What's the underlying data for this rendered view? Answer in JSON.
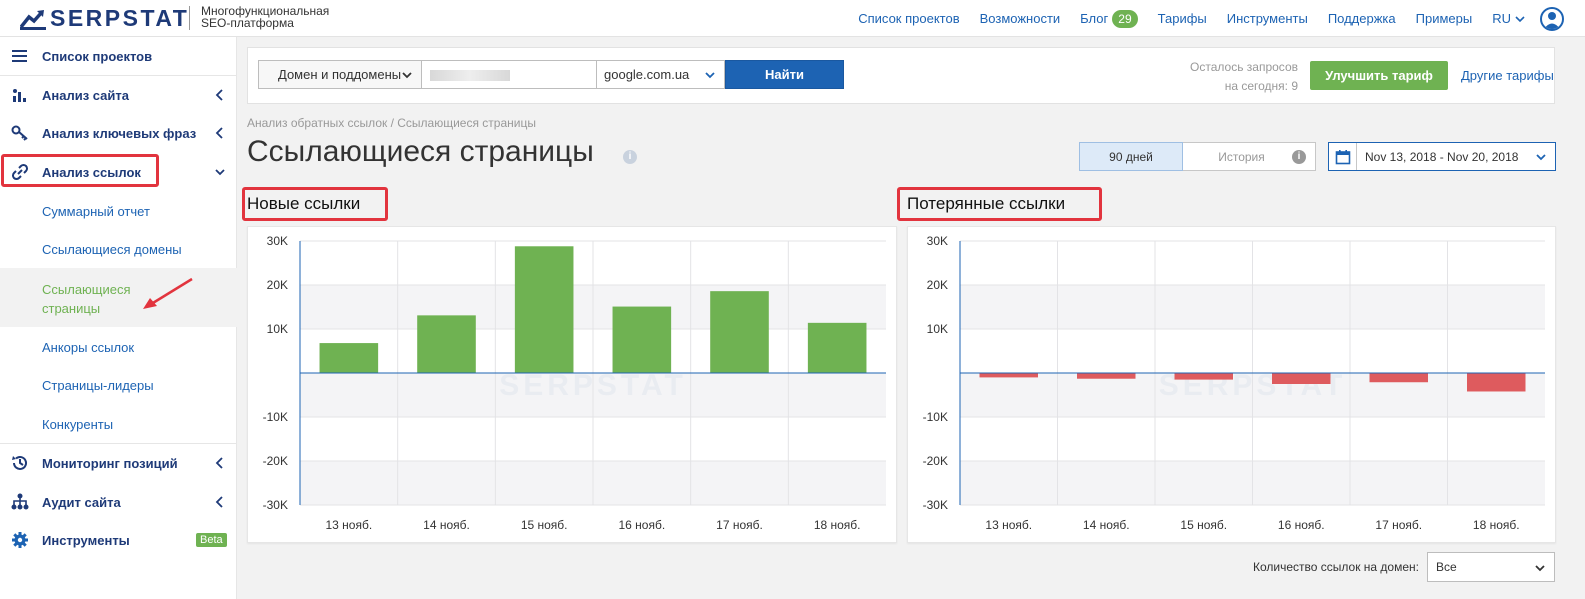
{
  "header": {
    "logo_text": "SERPSTAT",
    "tagline_line1": "Многофункциональная",
    "tagline_line2": "SEO-платформа",
    "nav": [
      "Список проектов",
      "Возможности",
      "Блог",
      "Тарифы",
      "Инструменты",
      "Поддержка",
      "Примеры"
    ],
    "blog_badge": "29",
    "lang": "RU"
  },
  "sidebar": {
    "projects": "Список проектов",
    "site_analysis": "Анализ сайта",
    "keyword_analysis": "Анализ ключевых фраз",
    "link_analysis": "Анализ ссылок",
    "subitems": [
      "Суммарный отчет",
      "Ссылающиеся домены",
      "Ссылающиеся",
      "страницы",
      "Анкоры ссылок",
      "Страницы-лидеры",
      "Конкуренты"
    ],
    "rank_tracking": "Мониторинг позиций",
    "site_audit": "Аудит сайта",
    "tools": "Инструменты",
    "beta": "Beta"
  },
  "search": {
    "scope": "Домен и поддомены",
    "engine": "google.com.ua",
    "find": "Найти",
    "remaining_line1": "Осталось запросов",
    "remaining_line2": "на сегодня: 9",
    "upgrade": "Улучшить тариф",
    "other_plans": "Другие тарифы"
  },
  "page": {
    "breadcrumb": "Анализ обратных ссылок / Ссылающиеся страницы",
    "title": "Ссылающиеся страницы",
    "period_90": "90 дней",
    "period_history": "История",
    "date_range": "Nov 13, 2018 - Nov 20, 2018",
    "per_domain_label": "Количество ссылок на домен:",
    "per_domain_value": "Все"
  },
  "colors": {
    "brand_blue": "#1d63b3",
    "green": "#6fb252",
    "red": "#de5b5e",
    "highlight": "#e2343e"
  },
  "chart_data": [
    {
      "type": "bar",
      "title": "Новые ссылки",
      "watermark": "SERPSTAT",
      "categories": [
        "13 нояб.",
        "14 нояб.",
        "15 нояб.",
        "16 нояб.",
        "17 нояб.",
        "18 нояб."
      ],
      "values": [
        6800,
        13100,
        28800,
        15100,
        18600,
        11400
      ],
      "ylim": [
        -30000,
        30000
      ],
      "yticks": [
        "30K",
        "20K",
        "10K",
        "",
        "-10K",
        "-20K",
        "-30K"
      ],
      "color": "#6fb252",
      "grid": true
    },
    {
      "type": "bar",
      "title": "Потерянные ссылки",
      "watermark": "SERPSTAT",
      "categories": [
        "13 нояб.",
        "14 нояб.",
        "15 нояб.",
        "16 нояб.",
        "17 нояб.",
        "18 нояб."
      ],
      "values": [
        -1000,
        -1300,
        -1500,
        -2500,
        -2100,
        -4200
      ],
      "ylim": [
        -30000,
        30000
      ],
      "yticks": [
        "30K",
        "20K",
        "10K",
        "",
        "-10K",
        "-20K",
        "-30K"
      ],
      "color": "#de5b5e",
      "grid": true
    }
  ]
}
